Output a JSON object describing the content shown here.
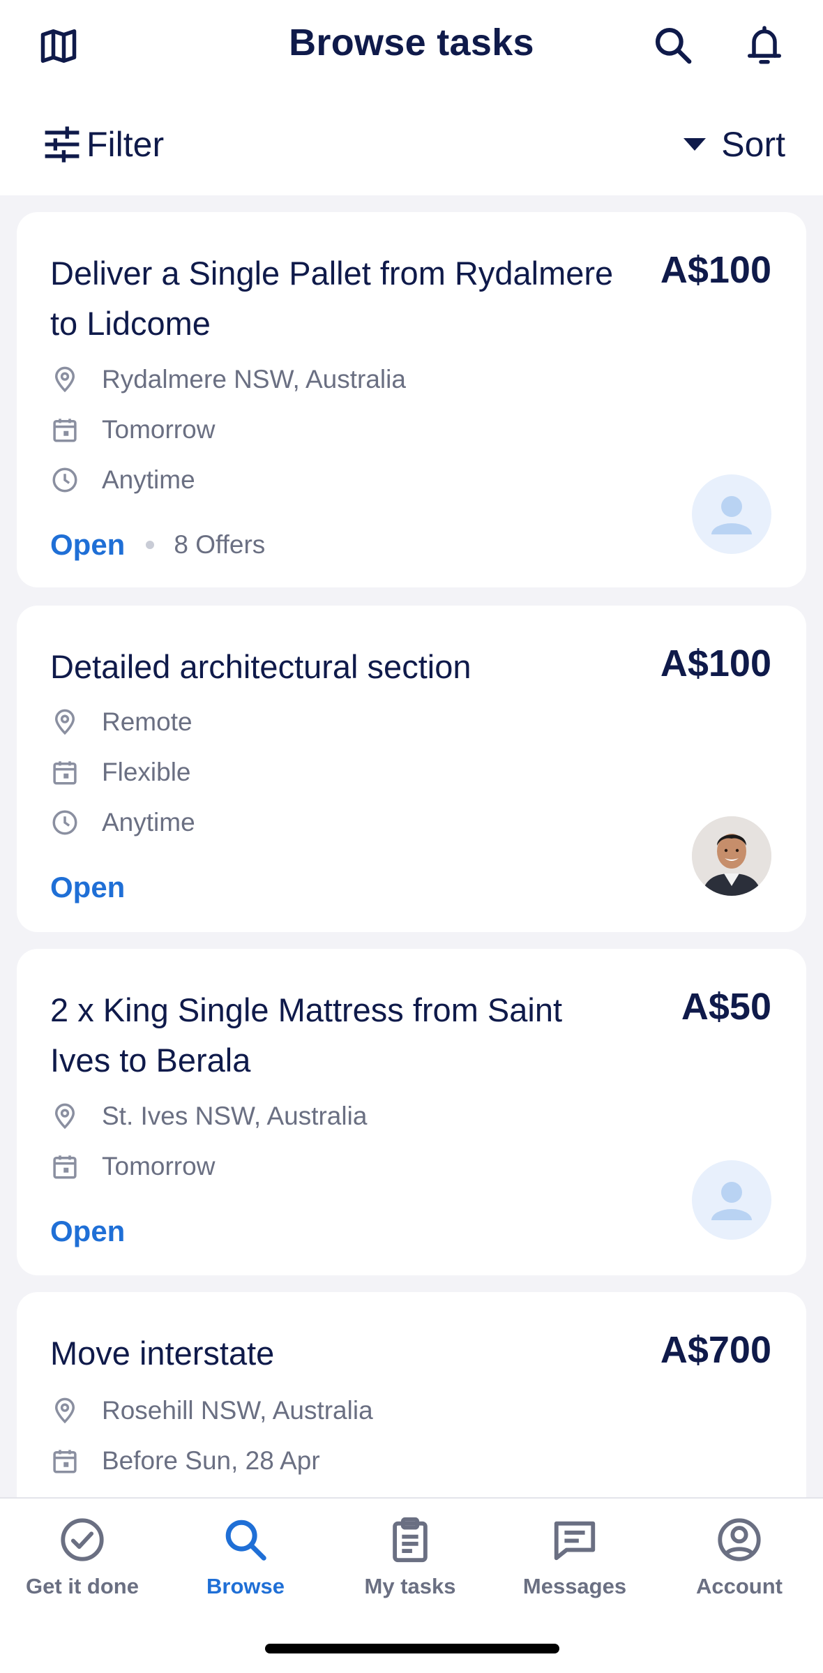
{
  "header": {
    "title": "Browse tasks",
    "filter_label": "Filter",
    "sort_label": "Sort"
  },
  "tasks": [
    {
      "title": "Deliver a Single Pallet from Rydalmere to Lidcome",
      "price": "A$100",
      "location": "Rydalmere NSW, Australia",
      "date": "Tomorrow",
      "time": "Anytime",
      "status": "Open",
      "offers": "8 Offers",
      "avatar": "placeholder"
    },
    {
      "title": "Detailed architectural section",
      "price": "A$100",
      "location": "Remote",
      "date": "Flexible",
      "time": "Anytime",
      "status": "Open",
      "avatar": "photo"
    },
    {
      "title": "2 x King Single Mattress from Saint Ives to Berala",
      "price": "A$50",
      "location": "St. Ives NSW, Australia",
      "date": "Tomorrow",
      "status": "Open",
      "avatar": "placeholder"
    },
    {
      "title": "Move interstate",
      "price": "A$700",
      "location": "Rosehill NSW, Australia",
      "date": "Before Sun, 28 Apr"
    }
  ],
  "nav": {
    "items": [
      {
        "label": "Get it done",
        "icon": "check-circle-icon"
      },
      {
        "label": "Browse",
        "icon": "search-icon",
        "active": true
      },
      {
        "label": "My tasks",
        "icon": "clipboard-icon"
      },
      {
        "label": "Messages",
        "icon": "message-icon"
      },
      {
        "label": "Account",
        "icon": "account-icon"
      }
    ]
  },
  "colors": {
    "primary_text": "#0f1a4a",
    "accent_blue": "#1f6fd6",
    "muted_text": "#6a6f82",
    "background": "#f3f3f7"
  }
}
